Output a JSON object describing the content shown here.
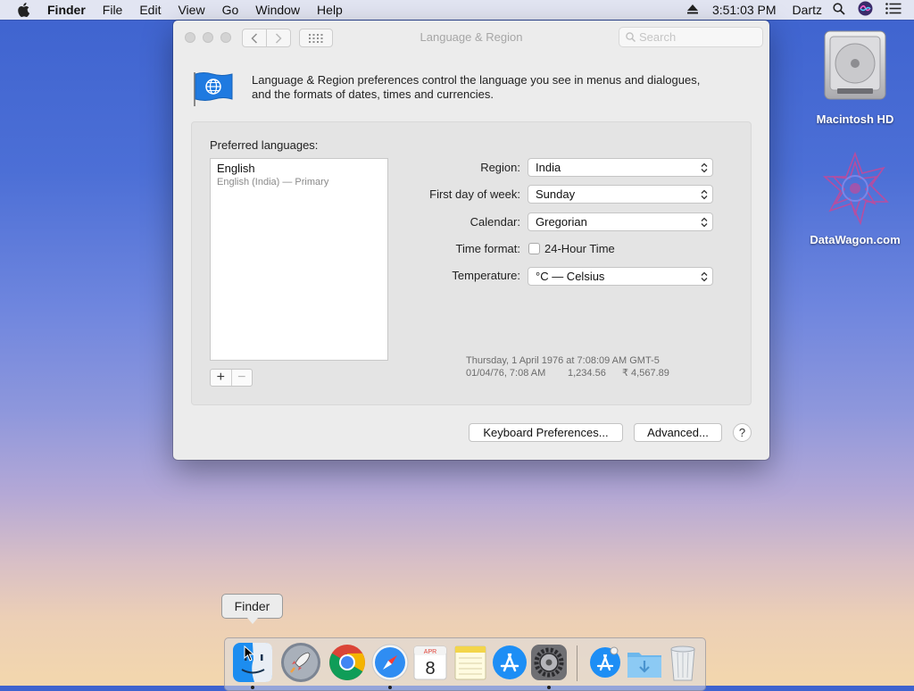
{
  "menubar": {
    "app_menu": "Finder",
    "menus": [
      "File",
      "Edit",
      "View",
      "Go",
      "Window",
      "Help"
    ],
    "clock": "3:51:03 PM",
    "user": "Dartz"
  },
  "window": {
    "title": "Language & Region",
    "search_placeholder": "Search",
    "description_line1": "Language & Region preferences control the language you see in menus and dialogues,",
    "description_line2": "and the formats of dates, times and currencies.",
    "preferred_languages_label": "Preferred languages:",
    "languages": [
      {
        "name": "English",
        "detail": "English (India) — Primary"
      }
    ],
    "fields": {
      "region": {
        "label": "Region:",
        "value": "India"
      },
      "first_day": {
        "label": "First day of week:",
        "value": "Sunday"
      },
      "calendar": {
        "label": "Calendar:",
        "value": "Gregorian"
      },
      "time_format": {
        "label": "Time format:",
        "checkbox_label": "24-Hour Time",
        "checked": false
      },
      "temperature": {
        "label": "Temperature:",
        "value": "°C — Celsius"
      }
    },
    "sample_line1": "Thursday, 1 April 1976 at 7:08:09 AM GMT-5",
    "sample_date_short": "01/04/76, 7:08 AM",
    "sample_number": "1,234.56",
    "sample_currency": "₹ 4,567.89",
    "keyboard_button": "Keyboard Preferences...",
    "advanced_button": "Advanced...",
    "help_button": "?"
  },
  "desktop": {
    "icons": [
      {
        "label": "Macintosh HD"
      },
      {
        "label": "DataWagon.com"
      }
    ]
  },
  "dock": {
    "tooltip": "Finder",
    "calendar_month": "APR",
    "calendar_day": "8",
    "items": [
      "finder-icon",
      "launchpad-icon",
      "chrome-icon",
      "safari-icon",
      "calendar-icon",
      "notes-icon",
      "app-store-icon",
      "system-preferences-icon",
      "app-store-icon",
      "downloads-folder-icon",
      "trash-icon"
    ]
  },
  "colors": {
    "accent": "#1f7ae0",
    "window_bg": "#ececec",
    "panel_bg": "#e4e4e4"
  }
}
